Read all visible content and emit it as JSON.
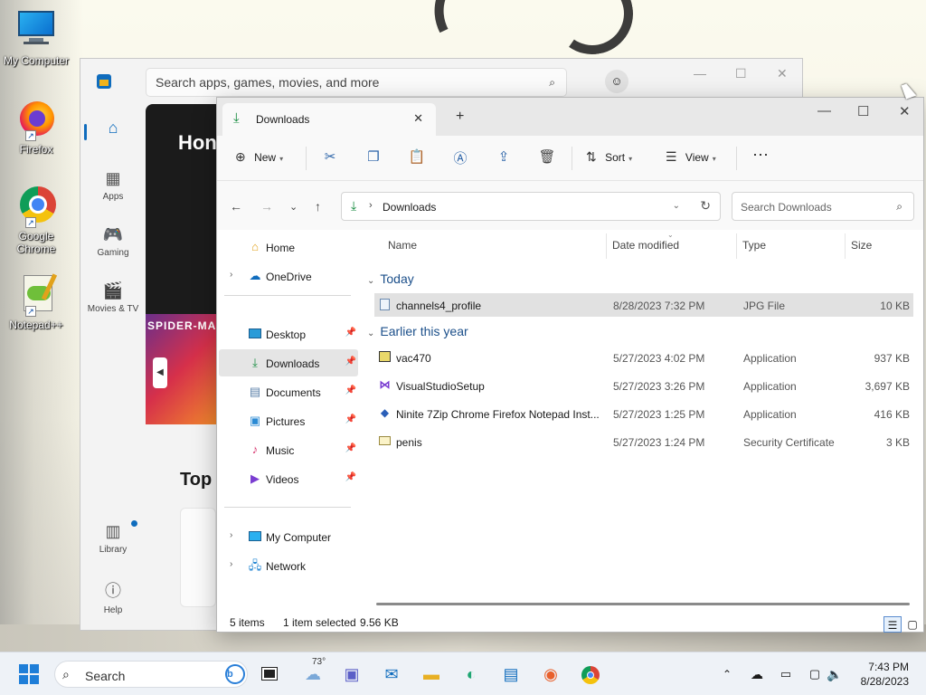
{
  "desktop": {
    "icons": [
      {
        "label": "My Computer",
        "icon": "monitor-icon"
      },
      {
        "label": "Firefox",
        "icon": "firefox-icon"
      },
      {
        "label": "Google Chrome",
        "icon": "chrome-icon"
      },
      {
        "label": "Notepad++",
        "icon": "notepadpp-icon"
      }
    ]
  },
  "store": {
    "search_placeholder": "Search apps, games, movies, and more",
    "nav": [
      {
        "label": "",
        "icon": "home-icon"
      },
      {
        "label": "Apps",
        "icon": "apps-icon"
      },
      {
        "label": "Gaming",
        "icon": "gamepad-icon"
      },
      {
        "label": "Movies & TV",
        "icon": "film-icon"
      },
      {
        "label": "Library",
        "icon": "library-icon"
      },
      {
        "label": "Help",
        "icon": "help-icon"
      }
    ],
    "hero_title": "Hon",
    "poster_text": "SPIDER-MA",
    "top_heading": "Top",
    "controls": {
      "minimize": "—",
      "maximize": "☐",
      "close": "✕"
    }
  },
  "explorer": {
    "tab_title": "Downloads",
    "new_tab": "+",
    "controls": {
      "minimize": "—",
      "maximize": "☐",
      "close": "✕"
    },
    "toolbar": {
      "new_label": "New",
      "sort_label": "Sort",
      "view_label": "View",
      "more_label": "···"
    },
    "address": {
      "folder": "Downloads"
    },
    "search_placeholder": "Search Downloads",
    "sidebar": [
      {
        "label": "Home",
        "icon": "home-icon",
        "expand": "",
        "pinned": false
      },
      {
        "label": "OneDrive",
        "icon": "cloud-icon",
        "expand": "›",
        "pinned": false
      },
      {
        "label": "Desktop",
        "icon": "desktop-icon",
        "expand": "",
        "pinned": true
      },
      {
        "label": "Downloads",
        "icon": "download-icon",
        "expand": "",
        "pinned": true
      },
      {
        "label": "Documents",
        "icon": "document-icon",
        "expand": "",
        "pinned": true
      },
      {
        "label": "Pictures",
        "icon": "picture-icon",
        "expand": "",
        "pinned": true
      },
      {
        "label": "Music",
        "icon": "music-icon",
        "expand": "",
        "pinned": true
      },
      {
        "label": "Videos",
        "icon": "video-icon",
        "expand": "",
        "pinned": true
      },
      {
        "label": "My Computer",
        "icon": "monitor-icon",
        "expand": "›",
        "pinned": false
      },
      {
        "label": "Network",
        "icon": "network-icon",
        "expand": "›",
        "pinned": false
      }
    ],
    "columns": {
      "name": "Name",
      "date": "Date modified",
      "type": "Type",
      "size": "Size"
    },
    "groups": [
      {
        "label": "Today",
        "files": [
          {
            "name": "channels4_profile",
            "date": "8/28/2023 7:32 PM",
            "type": "JPG File",
            "size": "10 KB",
            "icon": "image-file-icon",
            "selected": true
          }
        ]
      },
      {
        "label": "Earlier this year",
        "files": [
          {
            "name": "vac470",
            "date": "5/27/2023 4:02 PM",
            "type": "Application",
            "size": "937 KB",
            "icon": "app-exe-icon",
            "selected": false
          },
          {
            "name": "VisualStudioSetup",
            "date": "5/27/2023 3:26 PM",
            "type": "Application",
            "size": "3,697 KB",
            "icon": "visualstudio-icon",
            "selected": false
          },
          {
            "name": "Ninite 7Zip Chrome Firefox Notepad Inst...",
            "date": "5/27/2023 1:25 PM",
            "type": "Application",
            "size": "416 KB",
            "icon": "ninite-icon",
            "selected": false
          },
          {
            "name": "penis",
            "date": "5/27/2023 1:24 PM",
            "type": "Security Certificate",
            "size": "3 KB",
            "icon": "certificate-icon",
            "selected": false
          }
        ]
      }
    ],
    "status": {
      "items": "5 items",
      "selected": "1 item selected",
      "size": "9.56 KB"
    }
  },
  "taskbar": {
    "search_label": "Search",
    "weather": "73°",
    "time": "7:43 PM",
    "date": "8/28/2023"
  }
}
